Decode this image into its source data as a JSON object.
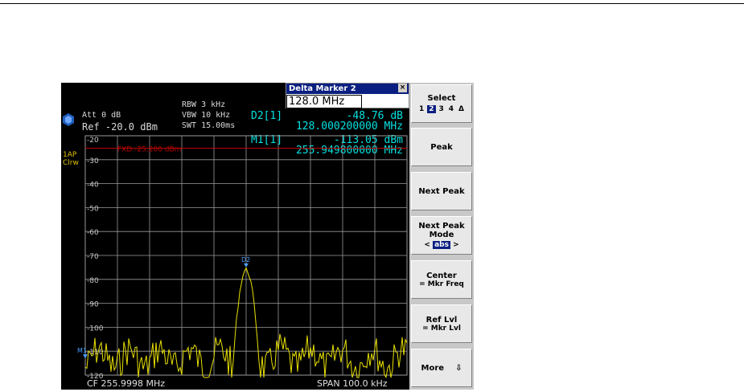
{
  "header": {
    "att": "Att  0 dB",
    "ref": "Ref -20.0 dBm",
    "rbw": "RBW  3 kHz",
    "vbw": "VBW  10 kHz",
    "swt": "SWT  15.00ms",
    "d2_label": "D2[1]",
    "d2_value": "-48.76 dB",
    "d2_freq": "128.000200000 MHz",
    "m1_label": "M1[1]",
    "m1_value": "-113.05 dBm",
    "m1_freq": "255.949800000 MHz"
  },
  "side": {
    "trace": "1AP",
    "mode": "Clrw"
  },
  "dialog": {
    "title": "Delta Marker 2",
    "close": "×",
    "value": "128.0 MHz"
  },
  "plot": {
    "fxd_label": "FXD -25.200 dBm",
    "y_ticks": [
      "-20",
      "-30",
      "-40",
      "-50",
      "-60",
      "-70",
      "-80",
      "-90",
      "-100",
      "-110",
      "-120"
    ],
    "marker_d2": "D2",
    "marker_m1": "M1"
  },
  "footer": {
    "cf": "CF 255.9998 MHz",
    "span": "SPAN 100.0 kHz"
  },
  "softkeys": {
    "select": "Select",
    "select_opts": [
      "1",
      "2",
      "3",
      "4",
      "Δ"
    ],
    "select_active": "2",
    "peak": "Peak",
    "next_peak": "Next Peak",
    "next_peak_mode_l1": "Next Peak",
    "next_peak_mode_l2": "Mode",
    "mode_left": "<",
    "mode_value": "abs",
    "mode_right": ">",
    "center_l1": "Center",
    "center_l2": "= Mkr Freq",
    "reflvl_l1": "Ref Lvl",
    "reflvl_l2": "= Mkr Lvl",
    "more": "More",
    "more_arrow": "⇩"
  },
  "colors": {
    "trace": "#e8e000",
    "marker": "#4aa0ff",
    "fxd_line": "#c00000",
    "grid": "#9a9a9a",
    "readout": "#00e0e0"
  }
}
